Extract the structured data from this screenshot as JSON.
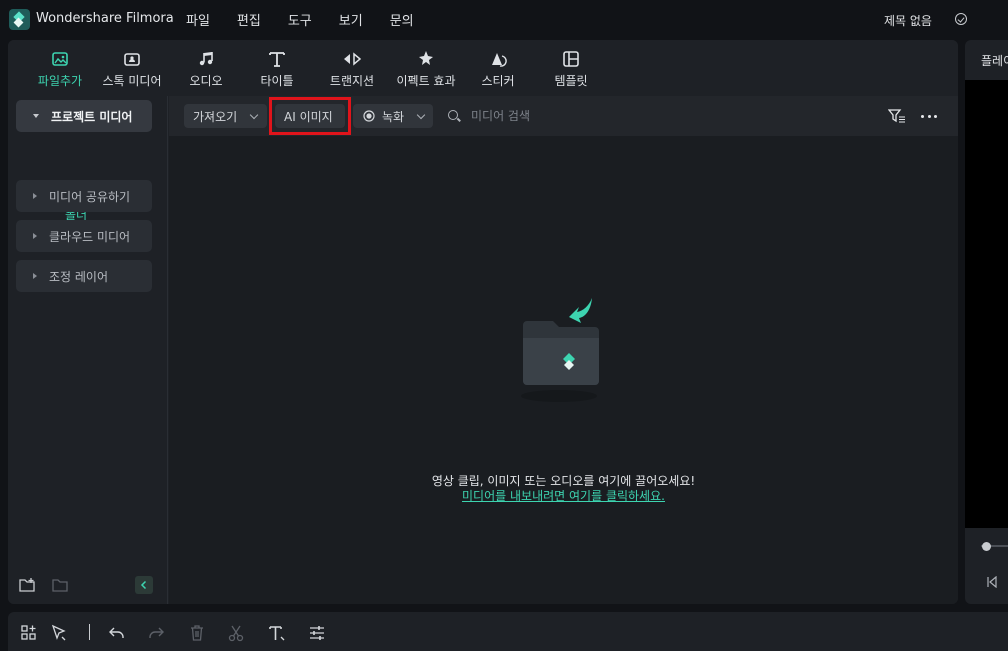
{
  "app": {
    "title": "Wondershare Filmora",
    "project_title": "제목 없음"
  },
  "menu": [
    "파일",
    "편집",
    "도구",
    "보기",
    "문의"
  ],
  "tabs": [
    {
      "label": "파일추가",
      "icon": "media-icon",
      "active": true
    },
    {
      "label": "스톡 미디어",
      "icon": "stock-media-icon",
      "active": false
    },
    {
      "label": "오디오",
      "icon": "music-note-icon",
      "active": false
    },
    {
      "label": "타이틀",
      "icon": "title-t-icon",
      "active": false
    },
    {
      "label": "트랜지션",
      "icon": "transition-icon",
      "active": false
    },
    {
      "label": "이펙트 효과",
      "icon": "effects-icon",
      "active": false
    },
    {
      "label": "스티커",
      "icon": "sticker-icon",
      "active": false
    },
    {
      "label": "템플릿",
      "icon": "template-icon",
      "active": false
    }
  ],
  "sidebar": {
    "project_media": "프로젝트 미디어",
    "folder": "폴더",
    "items": [
      "미디어 공유하기",
      "클라우드 미디어",
      "조정 레이어"
    ]
  },
  "toolbar": {
    "import": "가져오기",
    "ai_image": "AI 이미지",
    "record": "녹화",
    "search_placeholder": "미디어 검색"
  },
  "empty_state": {
    "message": "영상 클립, 이미지 또는 오디오를 여기에 끌어오세요!",
    "link": "미디어를 내보내려면 여기를 클릭하세요."
  },
  "preview": {
    "tab": "플레이어"
  },
  "colors": {
    "accent": "#3dd4b0",
    "highlight": "#e0141b",
    "background": "#111317",
    "panel": "#1e2126"
  }
}
